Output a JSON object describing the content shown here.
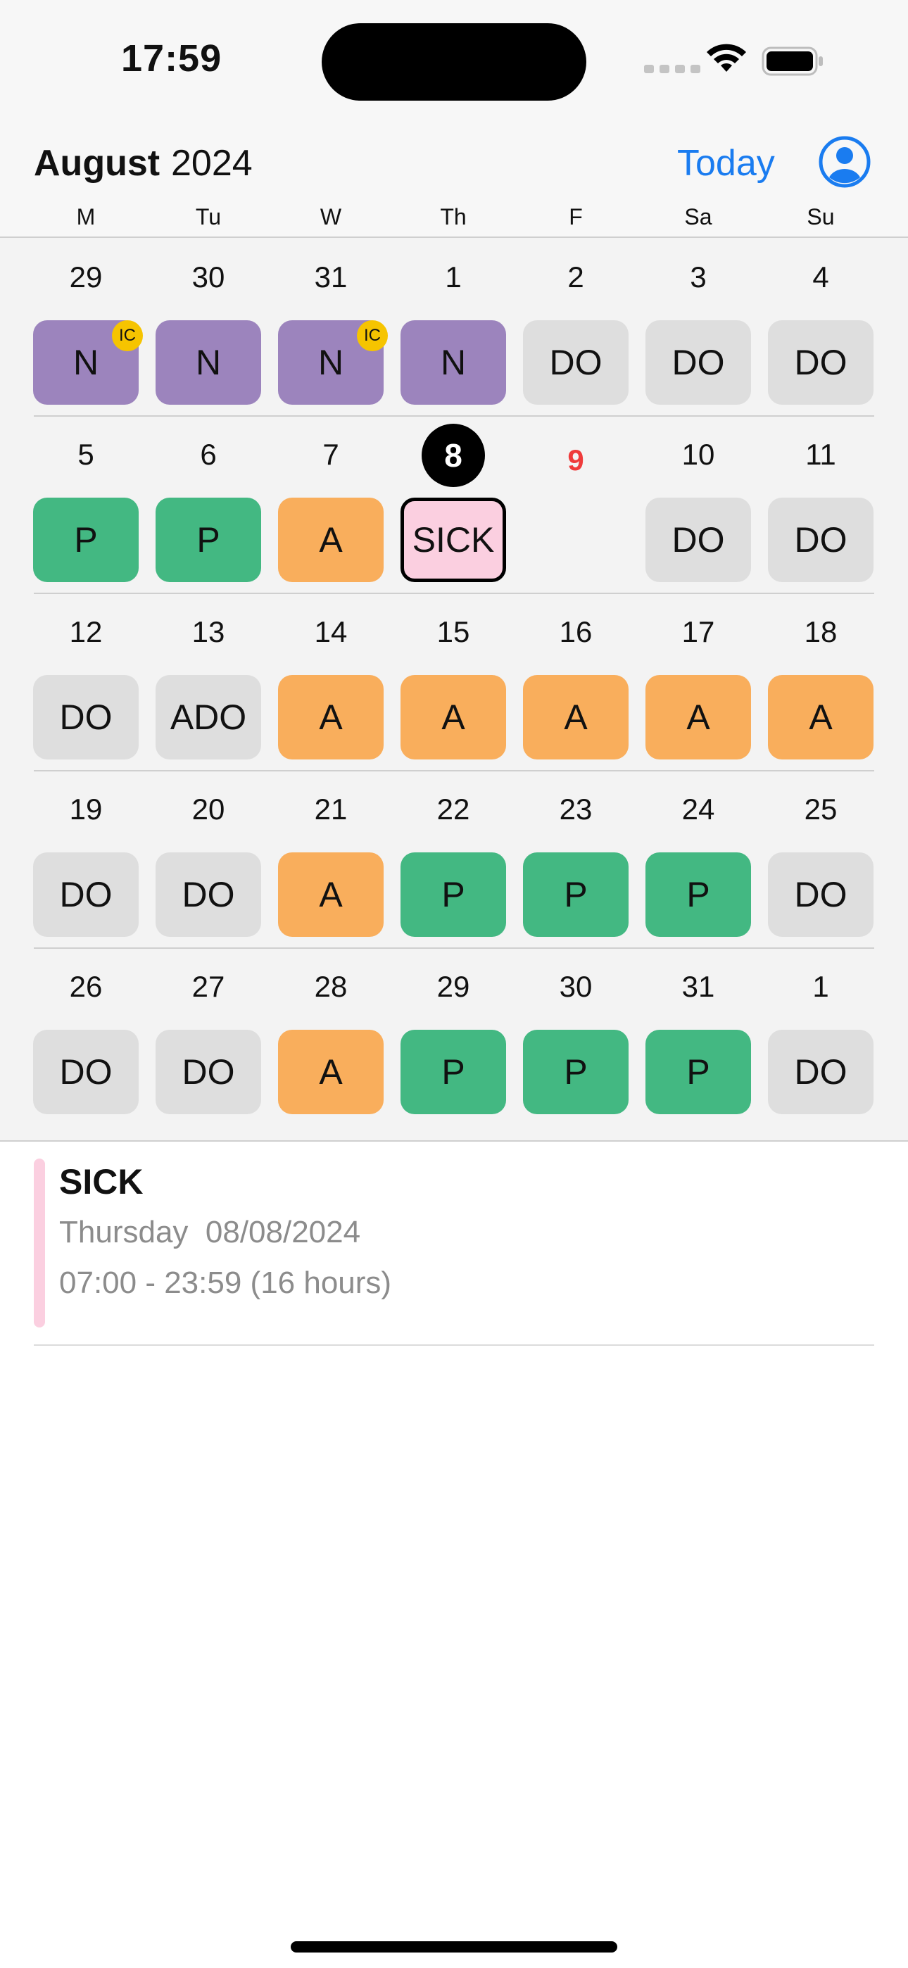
{
  "status_bar": {
    "time": "17:59"
  },
  "header": {
    "month": "August",
    "year": "2024",
    "today_label": "Today",
    "weekdays": [
      "M",
      "Tu",
      "W",
      "Th",
      "F",
      "Sa",
      "Su"
    ]
  },
  "weeks": [
    {
      "days": [
        {
          "num": "29",
          "shift": "N",
          "badge": "IC"
        },
        {
          "num": "30",
          "shift": "N"
        },
        {
          "num": "31",
          "shift": "N",
          "badge": "IC"
        },
        {
          "num": "1",
          "shift": "N"
        },
        {
          "num": "2",
          "shift": "DO"
        },
        {
          "num": "3",
          "shift": "DO"
        },
        {
          "num": "4",
          "shift": "DO"
        }
      ]
    },
    {
      "days": [
        {
          "num": "5",
          "shift": "P"
        },
        {
          "num": "6",
          "shift": "P"
        },
        {
          "num": "7",
          "shift": "A"
        },
        {
          "num": "8",
          "shift": "SICK",
          "selected": true
        },
        {
          "num": "9",
          "shift": "",
          "today": true
        },
        {
          "num": "10",
          "shift": "DO"
        },
        {
          "num": "11",
          "shift": "DO"
        }
      ]
    },
    {
      "days": [
        {
          "num": "12",
          "shift": "DO"
        },
        {
          "num": "13",
          "shift": "ADO"
        },
        {
          "num": "14",
          "shift": "A"
        },
        {
          "num": "15",
          "shift": "A"
        },
        {
          "num": "16",
          "shift": "A"
        },
        {
          "num": "17",
          "shift": "A"
        },
        {
          "num": "18",
          "shift": "A"
        }
      ]
    },
    {
      "days": [
        {
          "num": "19",
          "shift": "DO"
        },
        {
          "num": "20",
          "shift": "DO"
        },
        {
          "num": "21",
          "shift": "A"
        },
        {
          "num": "22",
          "shift": "P"
        },
        {
          "num": "23",
          "shift": "P"
        },
        {
          "num": "24",
          "shift": "P"
        },
        {
          "num": "25",
          "shift": "DO"
        }
      ]
    },
    {
      "days": [
        {
          "num": "26",
          "shift": "DO"
        },
        {
          "num": "27",
          "shift": "DO"
        },
        {
          "num": "28",
          "shift": "A"
        },
        {
          "num": "29",
          "shift": "P"
        },
        {
          "num": "30",
          "shift": "P"
        },
        {
          "num": "31",
          "shift": "P"
        },
        {
          "num": "1",
          "shift": "DO"
        }
      ]
    }
  ],
  "event": {
    "title": "SICK",
    "weekday": "Thursday",
    "date": "08/08/2024",
    "time": "07:00 - 23:59 (16 hours)"
  },
  "colors": {
    "N": "#9c84bd",
    "DO": "#dedede",
    "ADO": "#dedede",
    "P": "#43b882",
    "A": "#f9ae5c",
    "SICK": "#fbcfe0",
    "badge": "#f6c400",
    "accent": "#1a7cf0",
    "today": "#ef3b3b"
  },
  "icons": [
    "wifi-icon",
    "battery-icon",
    "profile-icon",
    "cellular-signal-icon"
  ]
}
